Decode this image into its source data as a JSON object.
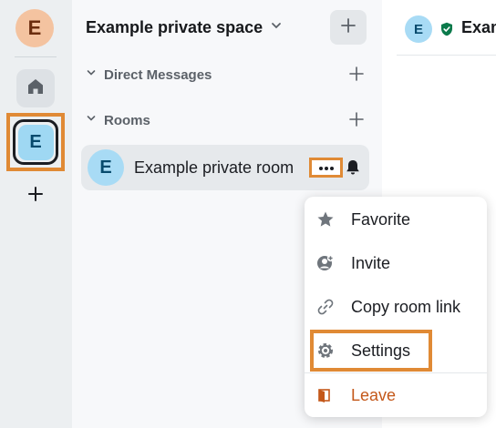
{
  "user": {
    "initial": "E"
  },
  "rail": {
    "space_initial": "E"
  },
  "space": {
    "title": "Example private space"
  },
  "sections": {
    "direct_messages": "Direct Messages",
    "rooms": "Rooms"
  },
  "room": {
    "initial": "E",
    "name": "Example private room"
  },
  "main": {
    "avatar_initial": "E",
    "title": "Exam"
  },
  "menu": {
    "favorite": "Favorite",
    "invite": "Invite",
    "copy_link": "Copy room link",
    "settings": "Settings",
    "leave": "Leave"
  },
  "colors": {
    "highlight": "#e08a35",
    "leave": "#c4581a",
    "shield": "#0b7a4b"
  }
}
